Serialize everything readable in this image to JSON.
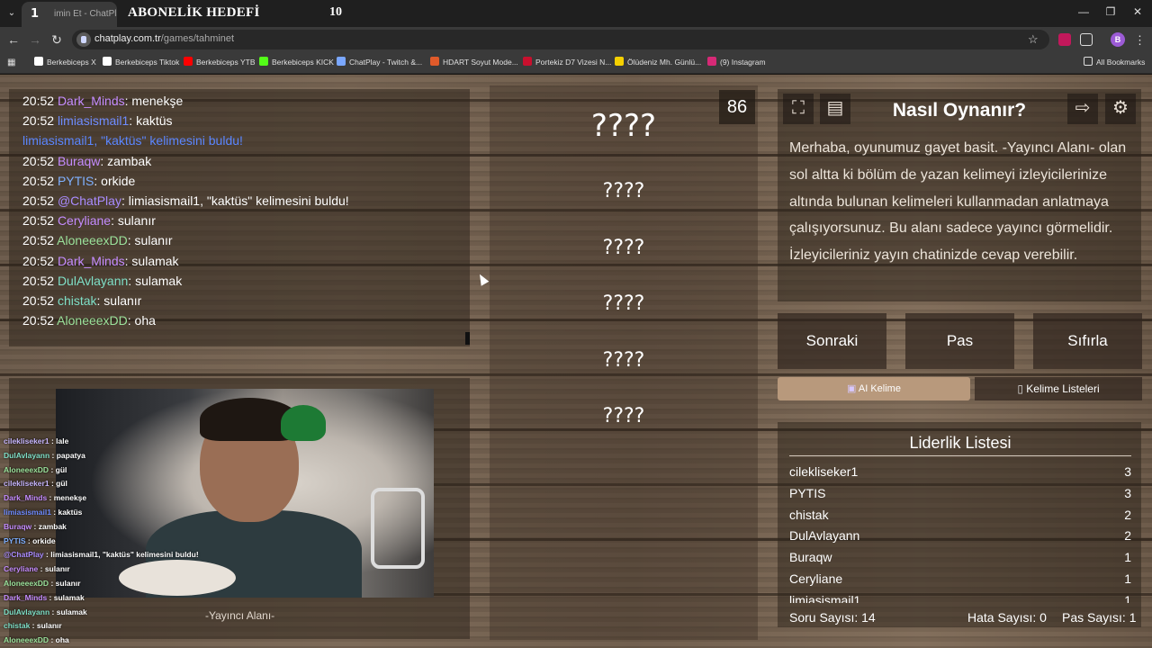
{
  "browser": {
    "tab_number": "1",
    "tab_title": "imin Et - ChatPlay",
    "overlay_title": "ABONELİK HEDEFİ",
    "overlay_count": "10",
    "url_host": "chatplay.com.tr",
    "url_path": "/games/tahminet",
    "bookmarks": [
      {
        "label": "Berkebiceps X",
        "icon": "x-icon",
        "color": "#ffffff"
      },
      {
        "label": "Berkebiceps Tiktok",
        "icon": "tiktok-icon",
        "color": "#ffffff"
      },
      {
        "label": "Berkebiceps YTB",
        "icon": "youtube-icon",
        "color": "#ff0000"
      },
      {
        "label": "Berkebiceps KICK",
        "icon": "kick-icon",
        "color": "#53fc18"
      },
      {
        "label": "ChatPlay - Twitch &...",
        "icon": "chatplay-icon",
        "color": "#7aa7ff"
      },
      {
        "label": "HDART Soyut Mode...",
        "icon": "hdart-icon",
        "color": "#e05a2a"
      },
      {
        "label": "Portekiz D7 Vizesi N...",
        "icon": "portugal-icon",
        "color": "#c8102e"
      },
      {
        "label": "Ölüdeniz Mh. Günlü...",
        "icon": "s-icon",
        "color": "#f5d000"
      },
      {
        "label": "(9) Instagram",
        "icon": "instagram-icon",
        "color": "#d62976"
      }
    ],
    "all_bookmarks": "All Bookmarks",
    "profile_initial": "B"
  },
  "chat": [
    {
      "time": "20:52",
      "user": "Dark_Minds",
      "color": "#c58cff",
      "msg": ": menekşe"
    },
    {
      "time": "20:52",
      "user": "limiasismail1",
      "color": "#6f8cff",
      "msg": ": kaktüs"
    },
    {
      "time": "",
      "user": "limiasismail1, \"kaktüs\" kelimesini buldu!",
      "color": "#5b86ff",
      "msg": ""
    },
    {
      "time": "20:52",
      "user": "Buraqw",
      "color": "#c58cff",
      "msg": ": zambak"
    },
    {
      "time": "20:52",
      "user": "PYTIS",
      "color": "#7fb0ff",
      "msg": ": orkide"
    },
    {
      "time": "20:52",
      "user": "@ChatPlay",
      "color": "#a98bff",
      "msg": ": limiasismail1, \"kaktüs\" kelimesini buldu!"
    },
    {
      "time": "20:52",
      "user": "Ceryliane",
      "color": "#c58cff",
      "msg": ": sulanır"
    },
    {
      "time": "20:52",
      "user": "AloneeexDD",
      "color": "#9be29b",
      "msg": ": sulanır"
    },
    {
      "time": "20:52",
      "user": "Dark_Minds",
      "color": "#c58cff",
      "msg": ": sulamak"
    },
    {
      "time": "20:52",
      "user": "DulAvlayann",
      "color": "#7fe0c8",
      "msg": ": sulamak"
    },
    {
      "time": "20:52",
      "user": "chistak",
      "color": "#7fe0c8",
      "msg": ": sulanır"
    },
    {
      "time": "20:52",
      "user": "AloneeexDD",
      "color": "#9be29b",
      "msg": ": oha"
    }
  ],
  "overlay_chat": [
    {
      "user": "cilekliseker1",
      "color": "#c8b7ff",
      "msg": " : lale"
    },
    {
      "user": "DulAvlayann",
      "color": "#7fe0c8",
      "msg": " : papatya"
    },
    {
      "user": "AloneeexDD",
      "color": "#9be29b",
      "msg": " : gül"
    },
    {
      "user": "cilekliseker1",
      "color": "#c8b7ff",
      "msg": " : gül"
    },
    {
      "user": "Dark_Minds",
      "color": "#c58cff",
      "msg": " : menekşe"
    },
    {
      "user": "limiasismail1",
      "color": "#6f8cff",
      "msg": " : kaktüs"
    },
    {
      "user": "Buraqw",
      "color": "#c58cff",
      "msg": " : zambak"
    },
    {
      "user": "PYTIS",
      "color": "#7fb0ff",
      "msg": " : orkide"
    },
    {
      "user": "@ChatPlay",
      "color": "#a98bff",
      "msg": " : limiasismail1, \"kaktüs\" kelimesini buldu!"
    },
    {
      "user": "Ceryliane",
      "color": "#c58cff",
      "msg": " : sulanır"
    },
    {
      "user": "AloneeexDD",
      "color": "#9be29b",
      "msg": " : sulanır"
    },
    {
      "user": "Dark_Minds",
      "color": "#c58cff",
      "msg": " : sulamak"
    },
    {
      "user": "DulAvlayann",
      "color": "#7fe0c8",
      "msg": " : sulamak"
    },
    {
      "user": "chistak",
      "color": "#7fe0c8",
      "msg": " : sulanır"
    },
    {
      "user": "AloneeexDD",
      "color": "#9be29b",
      "msg": " : oha"
    }
  ],
  "streamer_label": "-Yayıncı Alanı-",
  "counter": "86",
  "words": [
    "????",
    "????",
    "????",
    "????",
    "????",
    "????"
  ],
  "info": {
    "title": "Nasıl Oynanır?",
    "text": "Merhaba, oyunumuz gayet basit. -Yayıncı Alanı- olan sol altta ki bölüm de yazan kelimeyi izleyicilerinize altında bulunan kelimeleri kullanmadan anlatmaya çalışıyorsunuz. Bu alanı sadece yayıncı görmelidir. İzleyicileriniz yayın chatinizde cevap verebilir."
  },
  "buttons": {
    "next": "Sonraki",
    "pass": "Pas",
    "reset": "Sıfırla"
  },
  "tabs": {
    "ai": "AI Kelime",
    "lists": "Kelime Listeleri"
  },
  "leaderboard": {
    "title": "Liderlik Listesi",
    "rows": [
      {
        "name": "cilekliseker1",
        "score": "3"
      },
      {
        "name": "PYTIS",
        "score": "3"
      },
      {
        "name": "chistak",
        "score": "2"
      },
      {
        "name": "DulAvlayann",
        "score": "2"
      },
      {
        "name": "Buraqw",
        "score": "1"
      },
      {
        "name": "Ceryliane",
        "score": "1"
      },
      {
        "name": "limiasismail1",
        "score": "1"
      }
    ]
  },
  "stats": {
    "questions": "Soru Sayısı: 14",
    "errors": "Hata Sayısı: 0",
    "passes": "Pas Sayısı: 1"
  }
}
